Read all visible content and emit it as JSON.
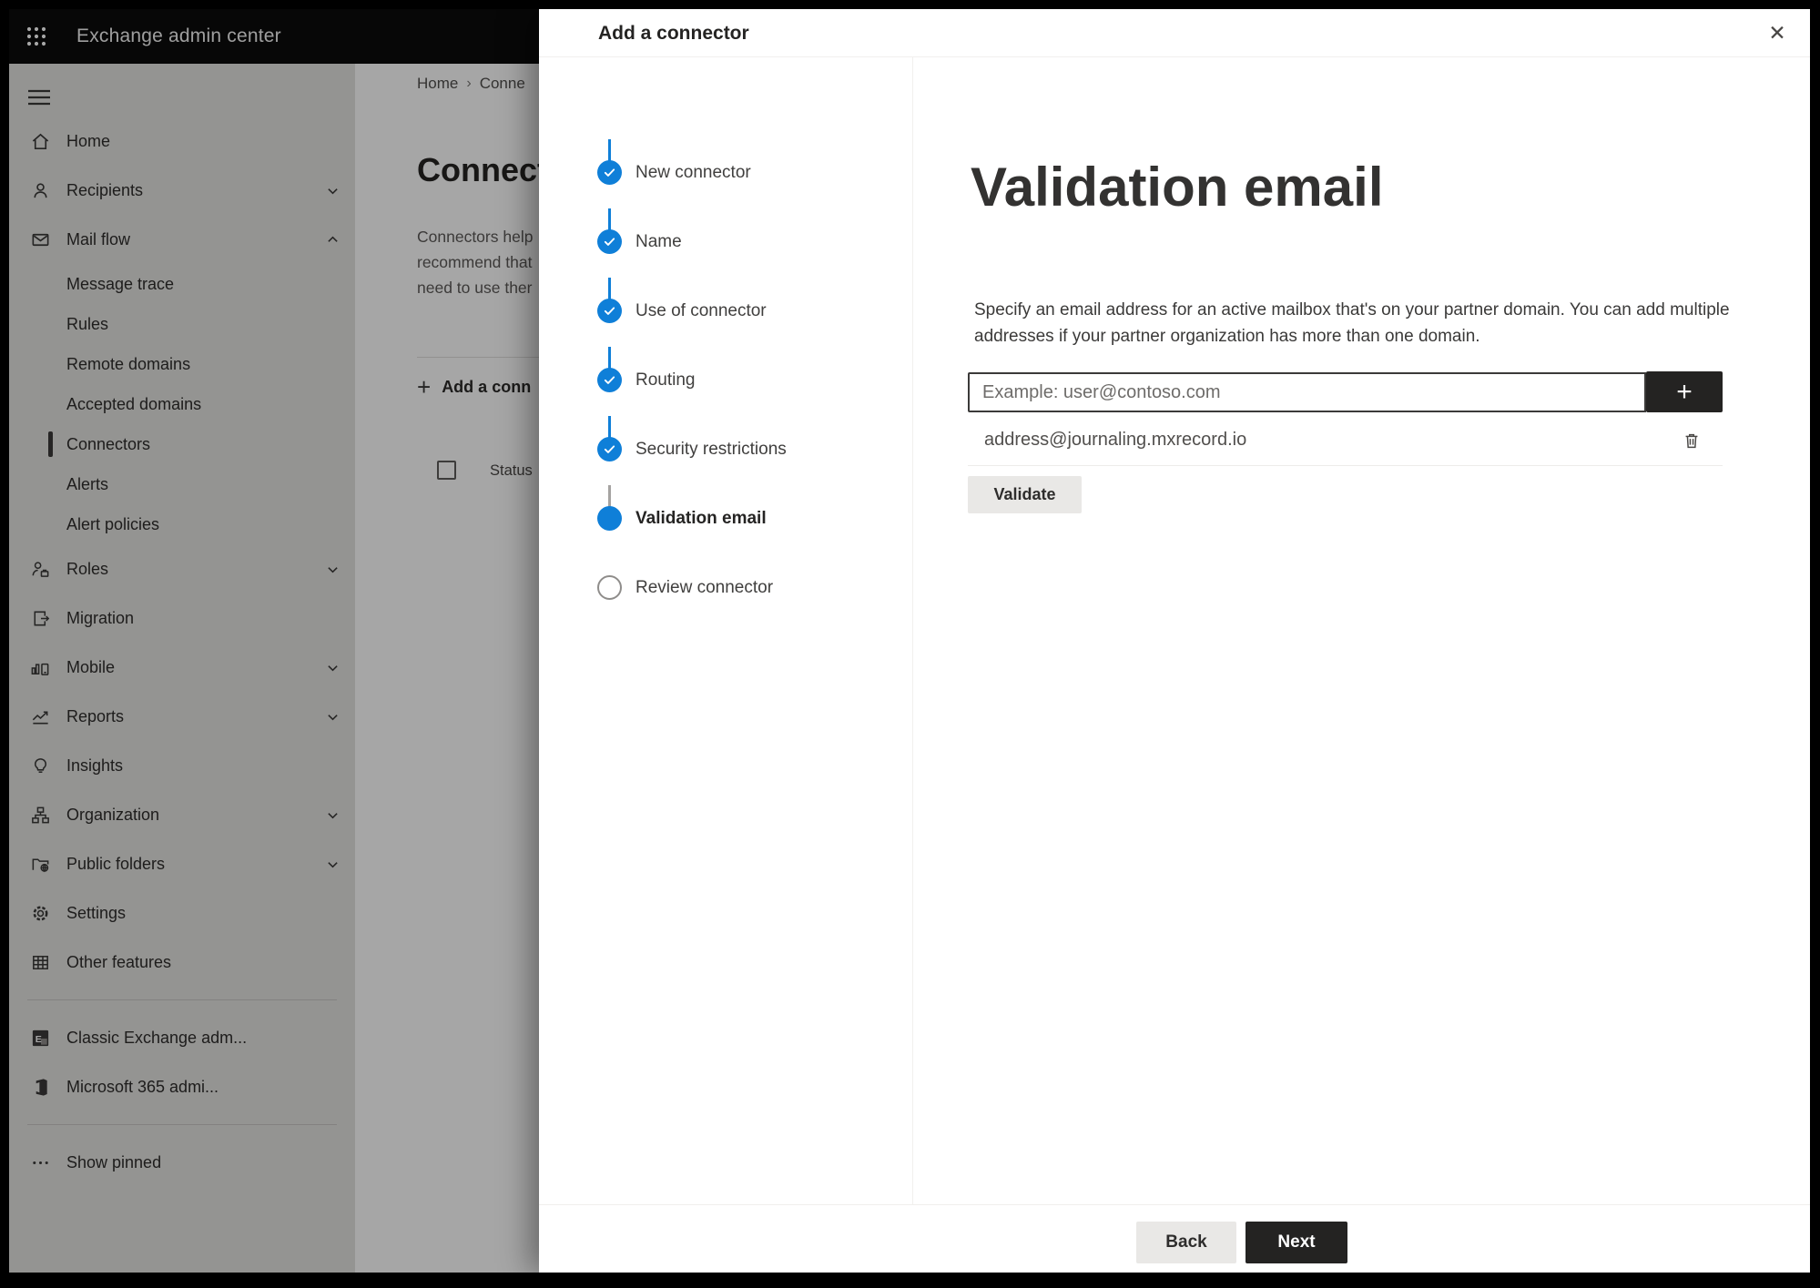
{
  "topbar": {
    "title": "Exchange admin center"
  },
  "sidebar": {
    "items": [
      {
        "label": "Home"
      },
      {
        "label": "Recipients"
      },
      {
        "label": "Mail flow"
      },
      {
        "label": "Message trace"
      },
      {
        "label": "Rules"
      },
      {
        "label": "Remote domains"
      },
      {
        "label": "Accepted domains"
      },
      {
        "label": "Connectors",
        "selected": true
      },
      {
        "label": "Alerts"
      },
      {
        "label": "Alert policies"
      },
      {
        "label": "Roles"
      },
      {
        "label": "Migration"
      },
      {
        "label": "Mobile"
      },
      {
        "label": "Reports"
      },
      {
        "label": "Insights"
      },
      {
        "label": "Organization"
      },
      {
        "label": "Public folders"
      },
      {
        "label": "Settings"
      },
      {
        "label": "Other features"
      },
      {
        "label": "Classic Exchange adm..."
      },
      {
        "label": "Microsoft 365 admi..."
      },
      {
        "label": "Show pinned"
      }
    ]
  },
  "page": {
    "breadcrumb": {
      "home": "Home",
      "separator": "›",
      "current": "Conne"
    },
    "title": "Connect",
    "body_lines": {
      "line1": "Connectors help",
      "line2": "recommend that",
      "line3": "need to use ther"
    },
    "add_button_plus": "+",
    "add_button_label": "Add a conn",
    "table_header": "Status"
  },
  "modal": {
    "title": "Add a connector",
    "close_glyph": "✕",
    "steps": [
      {
        "label": "New connector",
        "state": "completed"
      },
      {
        "label": "Name",
        "state": "completed"
      },
      {
        "label": "Use of connector",
        "state": "completed"
      },
      {
        "label": "Routing",
        "state": "completed"
      },
      {
        "label": "Security restrictions",
        "state": "completed"
      },
      {
        "label": "Validation email",
        "state": "current"
      },
      {
        "label": "Review connector",
        "state": "upcoming"
      }
    ],
    "content": {
      "heading": "Validation email",
      "description": "Specify an email address for an active mailbox that's on your partner domain. You can add multiple addresses if your partner organization has more than one domain.",
      "email_input": {
        "value": "",
        "placeholder": "Example: user@contoso.com"
      },
      "add_email_label": "+",
      "emails": [
        {
          "address": "address@journaling.mxrecord.io"
        }
      ],
      "validate_label": "Validate"
    },
    "footer": {
      "back_label": "Back",
      "next_label": "Next"
    }
  },
  "colors": {
    "accent_blue": "#0f7fd8",
    "dark_button": "#242322",
    "neutral_button": "#e9e8e6",
    "topbar_bg": "#0b0b0b",
    "sidebar_bg": "#e4e3e1",
    "overlay": "rgba(0,0,0,0.35)",
    "rail_gray": "#a5a3a1"
  }
}
